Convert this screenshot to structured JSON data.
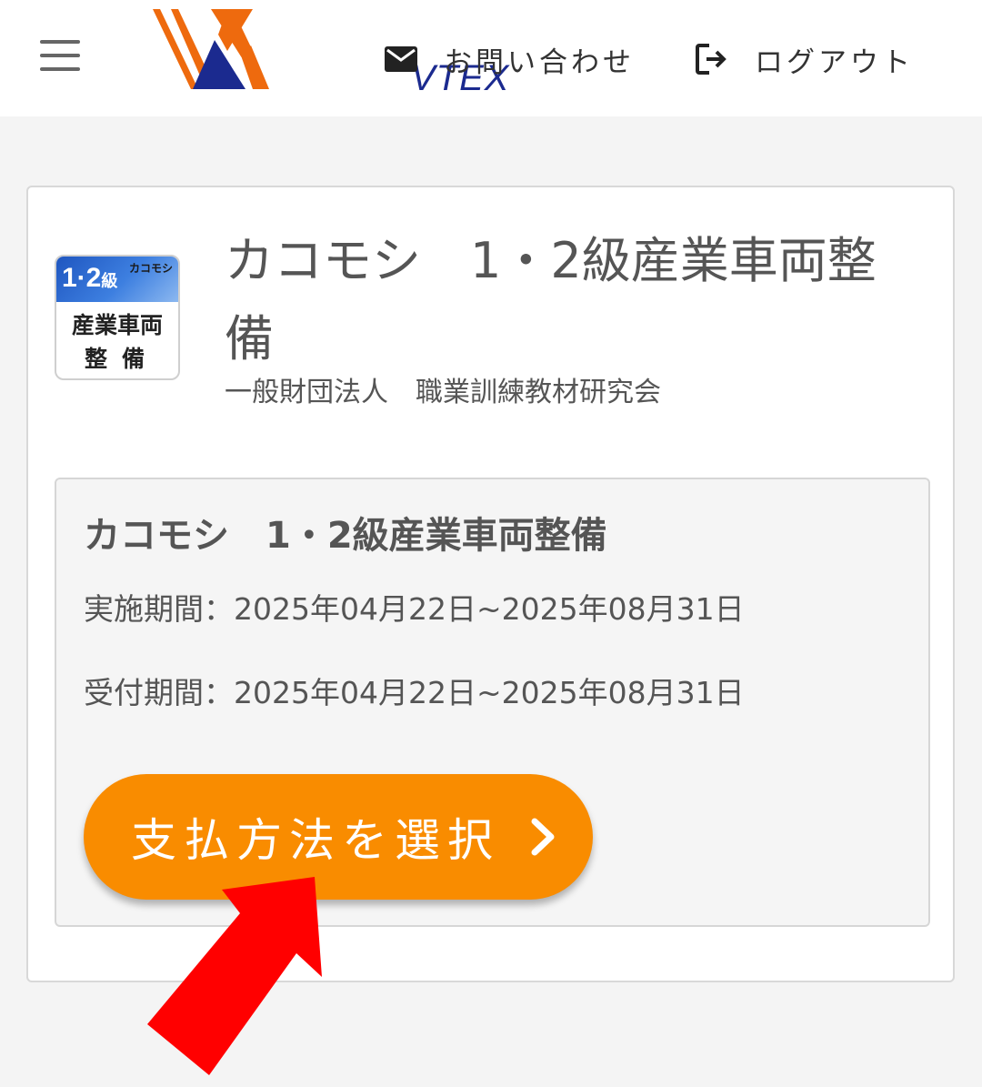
{
  "header": {
    "logo_text": "VTEX",
    "contact_label": "お問い合わせ",
    "logout_label": "ログアウト"
  },
  "course": {
    "thumbnail": {
      "grade": "1·2",
      "grade_suffix": "級",
      "brand": "カコモシ",
      "line1": "産業車両",
      "line2": "整備"
    },
    "title": "カコモシ　1・2級産業車両整備",
    "organization": "一般財団法人　職業訓練教材研究会",
    "plan": {
      "title": "カコモシ　1・2級産業車両整備",
      "implementation_period": "実施期間：2025年04月22日~2025年08月31日",
      "reception_period": "受付期間：2025年04月22日~2025年08月31日",
      "select_payment_label": "支払方法を選択"
    }
  },
  "colors": {
    "accent_orange": "#f98c00",
    "annotation_red": "#ff0000",
    "logo_orange": "#ee6a0e",
    "logo_navy": "#1b2a8f"
  },
  "icons": {
    "menu": "hamburger-menu-icon",
    "contact": "mail-icon",
    "logout": "logout-icon",
    "button": "chevron-right-icon",
    "annotation": "red-arrow-icon"
  }
}
